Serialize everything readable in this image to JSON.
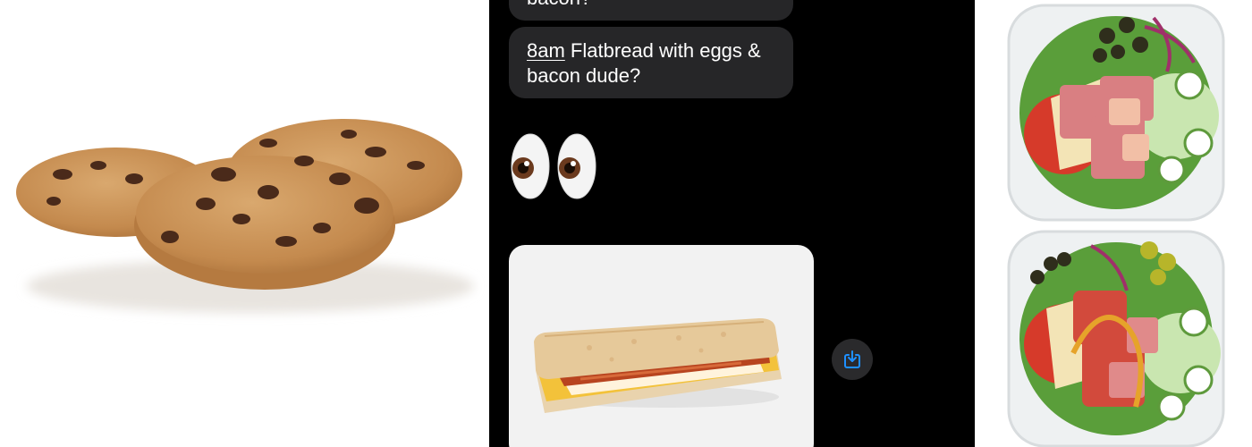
{
  "conversation": {
    "previous_message_tail": "bacon?",
    "message": {
      "time": "8am",
      "text_part1": "Flatbread with eggs &",
      "text_part2": "bacon dude?"
    },
    "reaction_emoji": "eyes-emoji",
    "attachment_icon": "flatbread-sandwich-photo",
    "save_icon": "save-to-photos-icon"
  },
  "side_images": {
    "left": "chocolate-chip-cookies-photo",
    "right_top": "chef-salad-bowl-photo",
    "right_bottom": "italian-salad-bowl-photo"
  },
  "colors": {
    "chat_background": "#000000",
    "bubble_background": "#262628",
    "bubble_text": "#ffffff",
    "save_icon_color": "#1e90ff"
  }
}
